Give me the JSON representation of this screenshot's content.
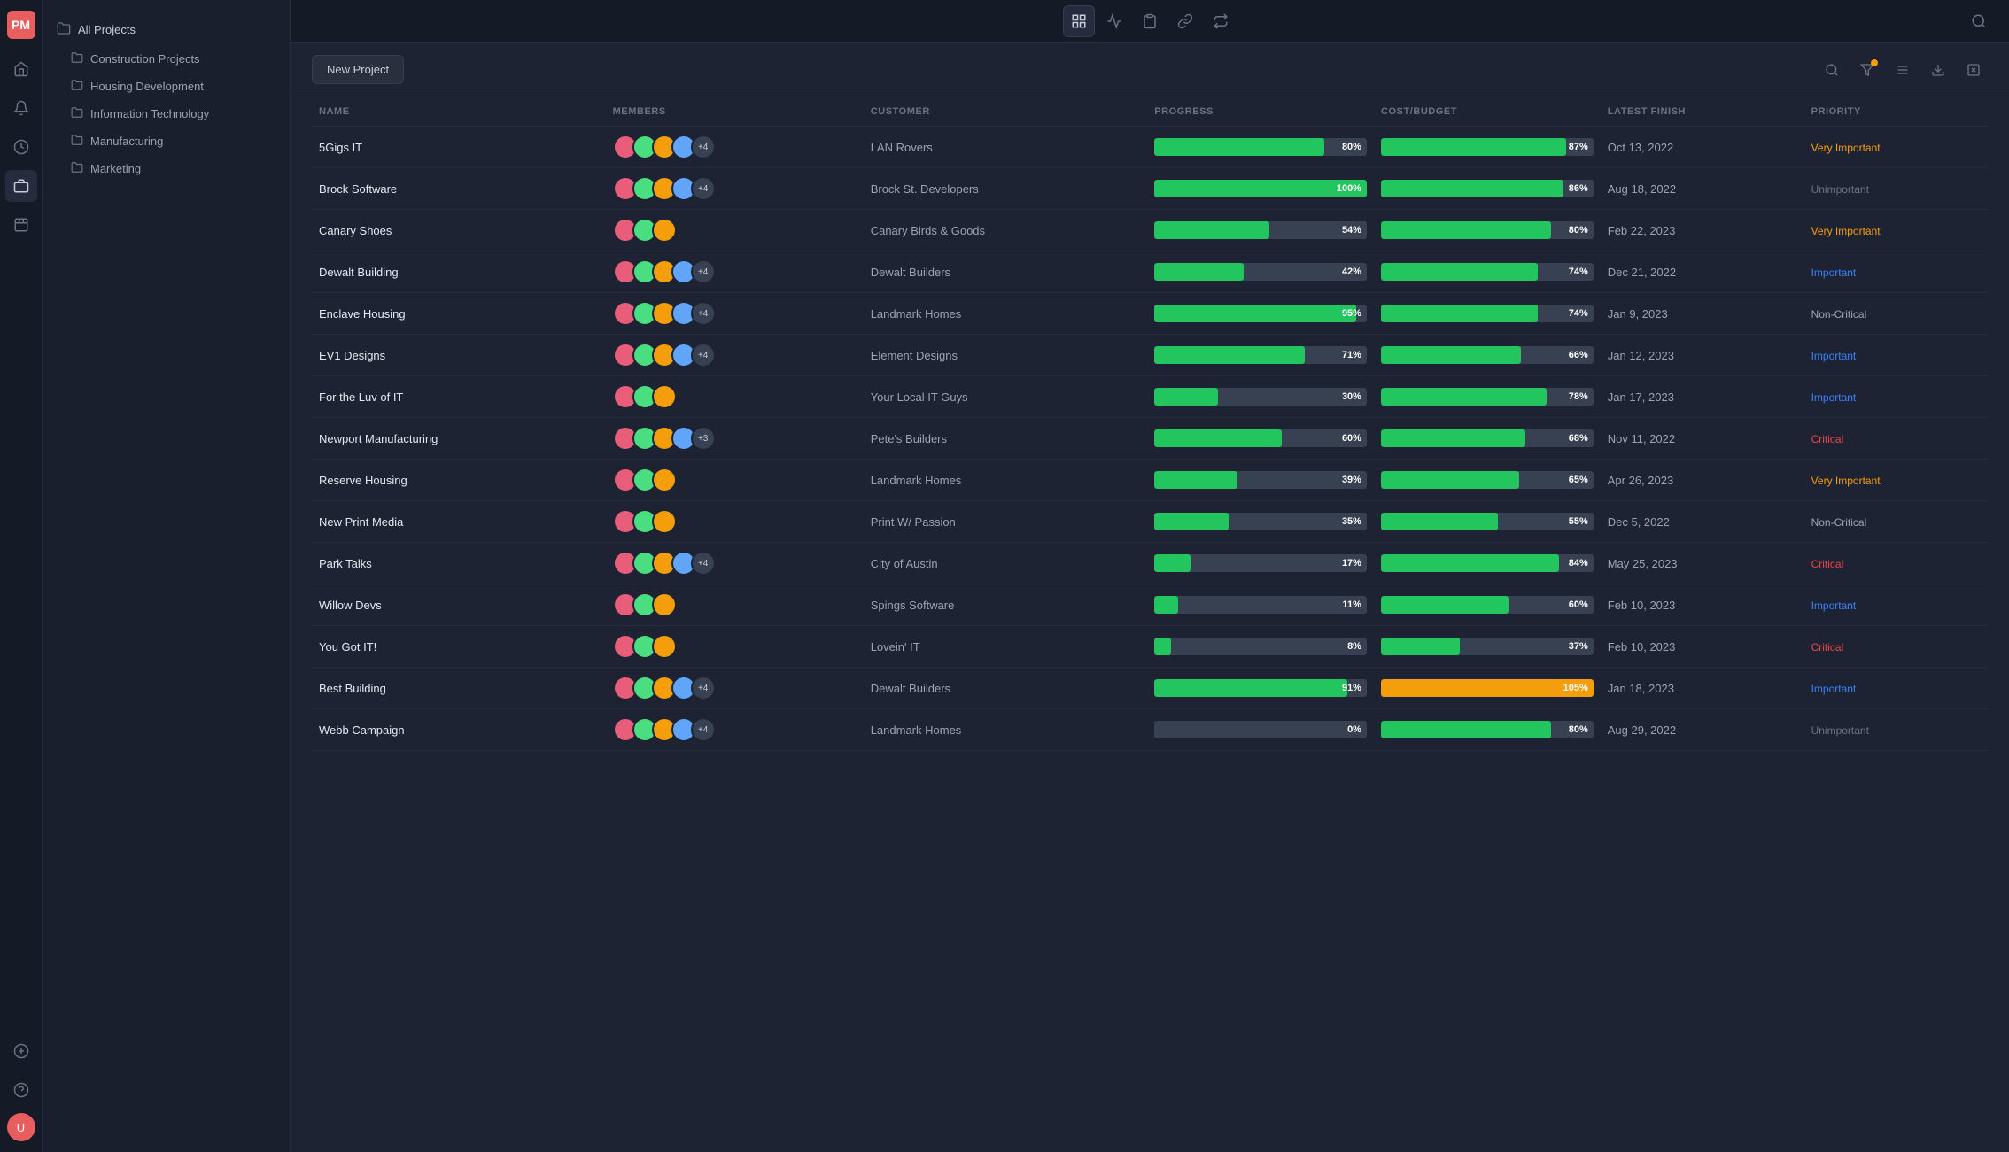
{
  "app": {
    "logo": "PM",
    "title": "All Projects"
  },
  "toolbar": {
    "icons": [
      "grid-icon",
      "chart-icon",
      "list-icon",
      "link-icon",
      "flow-icon"
    ],
    "new_project_label": "New Project"
  },
  "sidebar": {
    "all_projects_label": "All Projects",
    "items": [
      {
        "label": "Construction Projects"
      },
      {
        "label": "Housing Development"
      },
      {
        "label": "Information Technology"
      },
      {
        "label": "Manufacturing"
      },
      {
        "label": "Marketing"
      }
    ]
  },
  "table": {
    "columns": [
      "NAME",
      "MEMBERS",
      "CUSTOMER",
      "PROGRESS",
      "COST/BUDGET",
      "LATEST FINISH",
      "PRIORITY"
    ],
    "rows": [
      {
        "name": "5Gigs IT",
        "members_extra": "+4",
        "customer": "LAN Rovers",
        "progress": 80,
        "cost_pct": 87,
        "cost_color": "green",
        "finish": "Oct 13, 2022",
        "priority": "Very Important",
        "priority_class": "priority-very-important"
      },
      {
        "name": "Brock Software",
        "members_extra": "+4",
        "customer": "Brock St. Developers",
        "progress": 100,
        "cost_pct": 86,
        "cost_color": "green",
        "finish": "Aug 18, 2022",
        "priority": "Unimportant",
        "priority_class": "priority-unimportant"
      },
      {
        "name": "Canary Shoes",
        "members_extra": "",
        "customer": "Canary Birds & Goods",
        "progress": 54,
        "cost_pct": 80,
        "cost_color": "green",
        "finish": "Feb 22, 2023",
        "priority": "Very Important",
        "priority_class": "priority-very-important"
      },
      {
        "name": "Dewalt Building",
        "members_extra": "+4",
        "customer": "Dewalt Builders",
        "progress": 42,
        "cost_pct": 74,
        "cost_color": "green",
        "finish": "Dec 21, 2022",
        "priority": "Important",
        "priority_class": "priority-important"
      },
      {
        "name": "Enclave Housing",
        "members_extra": "+4",
        "customer": "Landmark Homes",
        "progress": 95,
        "cost_pct": 74,
        "cost_color": "green",
        "finish": "Jan 9, 2023",
        "priority": "Non-Critical",
        "priority_class": "priority-non-critical"
      },
      {
        "name": "EV1 Designs",
        "members_extra": "+4",
        "customer": "Element Designs",
        "progress": 71,
        "cost_pct": 66,
        "cost_color": "green",
        "finish": "Jan 12, 2023",
        "priority": "Important",
        "priority_class": "priority-important"
      },
      {
        "name": "For the Luv of IT",
        "members_extra": "",
        "customer": "Your Local IT Guys",
        "progress": 30,
        "cost_pct": 78,
        "cost_color": "green",
        "finish": "Jan 17, 2023",
        "priority": "Important",
        "priority_class": "priority-important"
      },
      {
        "name": "Newport Manufacturing",
        "members_extra": "+3",
        "customer": "Pete's Builders",
        "progress": 60,
        "cost_pct": 68,
        "cost_color": "green",
        "finish": "Nov 11, 2022",
        "priority": "Critical",
        "priority_class": "priority-critical"
      },
      {
        "name": "Reserve Housing",
        "members_extra": "",
        "customer": "Landmark Homes",
        "progress": 39,
        "cost_pct": 65,
        "cost_color": "green",
        "finish": "Apr 26, 2023",
        "priority": "Very Important",
        "priority_class": "priority-very-important"
      },
      {
        "name": "New Print Media",
        "members_extra": "",
        "customer": "Print W/ Passion",
        "progress": 35,
        "cost_pct": 55,
        "cost_color": "green",
        "finish": "Dec 5, 2022",
        "priority": "Non-Critical",
        "priority_class": "priority-non-critical"
      },
      {
        "name": "Park Talks",
        "members_extra": "+4",
        "customer": "City of Austin",
        "progress": 17,
        "cost_pct": 84,
        "cost_color": "green",
        "finish": "May 25, 2023",
        "priority": "Critical",
        "priority_class": "priority-critical"
      },
      {
        "name": "Willow Devs",
        "members_extra": "",
        "customer": "Spings Software",
        "progress": 11,
        "cost_pct": 60,
        "cost_color": "green",
        "finish": "Feb 10, 2023",
        "priority": "Important",
        "priority_class": "priority-important"
      },
      {
        "name": "You Got IT!",
        "members_extra": "",
        "customer": "Lovein' IT",
        "progress": 8,
        "cost_pct": 37,
        "cost_color": "green",
        "finish": "Feb 10, 2023",
        "priority": "Critical",
        "priority_class": "priority-critical"
      },
      {
        "name": "Best Building",
        "members_extra": "+4",
        "customer": "Dewalt Builders",
        "progress": 91,
        "cost_pct": 105,
        "cost_color": "orange",
        "finish": "Jan 18, 2023",
        "priority": "Important",
        "priority_class": "priority-important"
      },
      {
        "name": "Webb Campaign",
        "members_extra": "+4",
        "customer": "Landmark Homes",
        "progress": 0,
        "cost_pct": 80,
        "cost_color": "green",
        "finish": "Aug 29, 2022",
        "priority": "Unimportant",
        "priority_class": "priority-unimportant"
      }
    ]
  }
}
